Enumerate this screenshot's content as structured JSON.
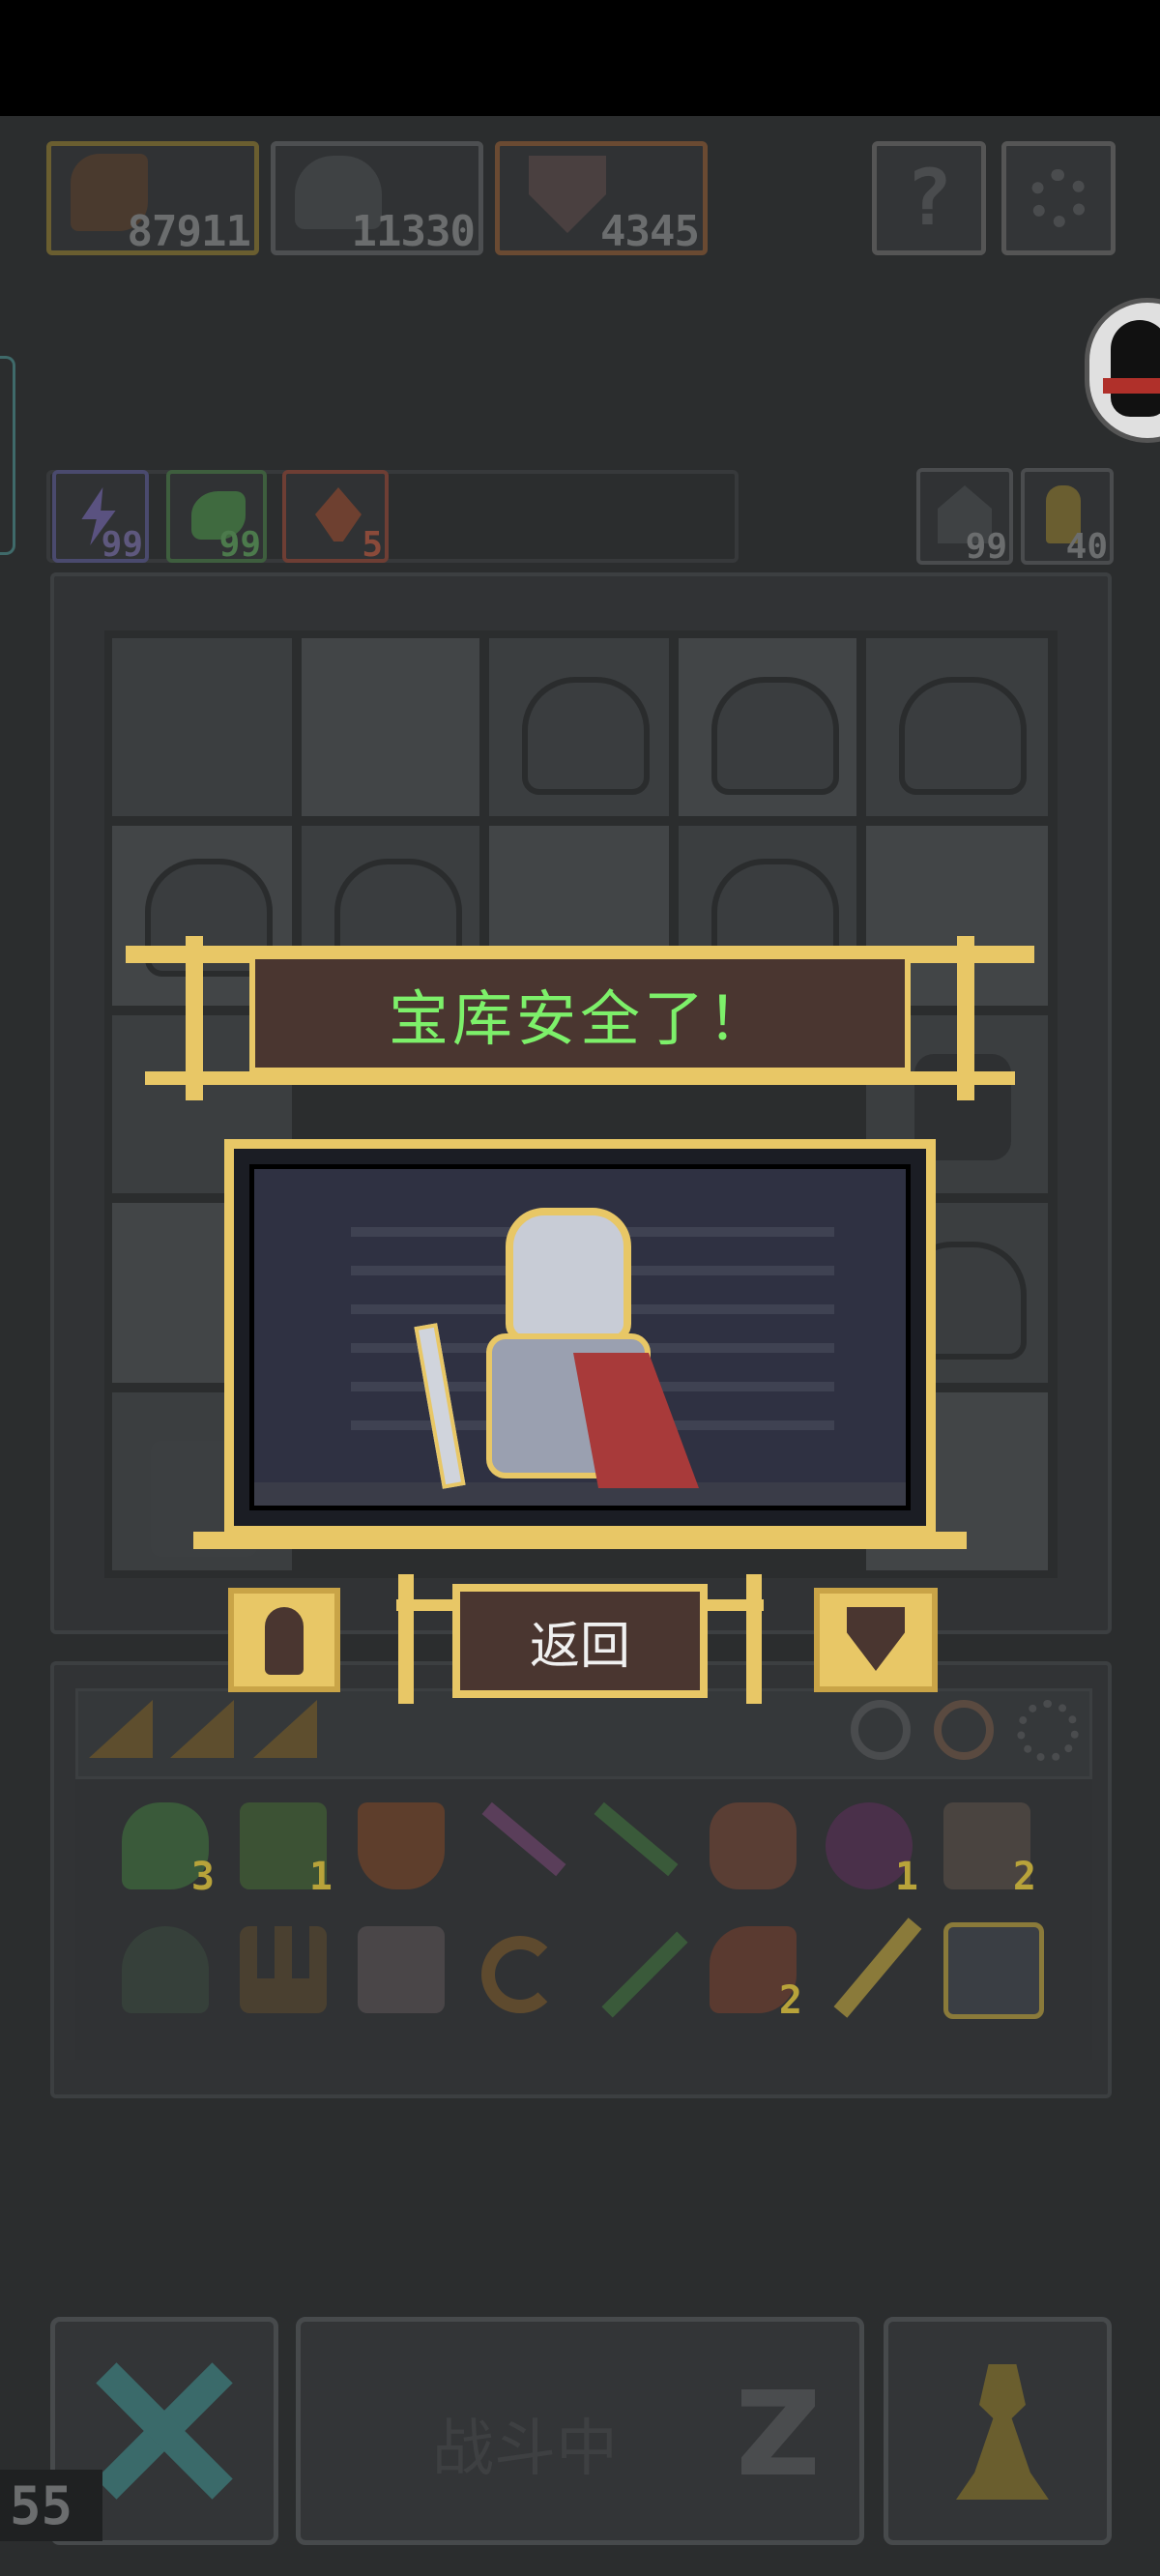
{
  "colors": {
    "gold": "#e8c766",
    "banner_text": "#7df06a",
    "dark_brown": "#4a3630",
    "background": "#2b2d2e"
  },
  "resources": [
    {
      "icon": "axe-icon",
      "value": "87911",
      "border": "#8a7a3a"
    },
    {
      "icon": "helmet-icon",
      "value": "11330",
      "border": "#5a5c5e"
    },
    {
      "icon": "shield-down-icon",
      "value": "4345",
      "border": "#8a5a3a"
    }
  ],
  "top_buttons": [
    {
      "icon": "question-icon"
    },
    {
      "icon": "gear-icon"
    }
  ],
  "small_resources": [
    {
      "icon": "lightning-icon",
      "value": "99",
      "border": "#5a5a8a",
      "color": "#7a6fa8"
    },
    {
      "icon": "leaf-icon",
      "value": "99",
      "border": "#4a7a4a",
      "color": "#5c8c5c"
    },
    {
      "icon": "fire-icon",
      "value": "5",
      "border": "#8a4a3a",
      "color": "#a85a4a"
    }
  ],
  "right_counters": [
    {
      "icon": "house-icon",
      "value": "99"
    },
    {
      "icon": "key-icon",
      "value": "40"
    }
  ],
  "dialog": {
    "title": "宝库安全了！",
    "back_label": "返回"
  },
  "inventory": {
    "row1": [
      {
        "icon": "gem-icon",
        "count": "3"
      },
      {
        "icon": "goblin-icon",
        "count": "1"
      },
      {
        "icon": "shield-icon",
        "count": ""
      },
      {
        "icon": "arrow-purple-icon",
        "count": ""
      },
      {
        "icon": "arrow-green-icon",
        "count": ""
      },
      {
        "icon": "glove-icon",
        "count": ""
      },
      {
        "icon": "demon-icon",
        "count": "1"
      },
      {
        "icon": "scroll-icon",
        "count": "2"
      }
    ],
    "row2": [
      {
        "icon": "bell-icon",
        "count": ""
      },
      {
        "icon": "trident-icon",
        "count": ""
      },
      {
        "icon": "card-icon",
        "count": ""
      },
      {
        "icon": "sickle-icon",
        "count": ""
      },
      {
        "icon": "sword-green-icon",
        "count": ""
      },
      {
        "icon": "axe-red-icon",
        "count": "2"
      },
      {
        "icon": "wand-icon",
        "count": ""
      },
      {
        "icon": "crown-icon",
        "count": ""
      }
    ]
  },
  "battle_label": "战斗中",
  "fps": "55"
}
